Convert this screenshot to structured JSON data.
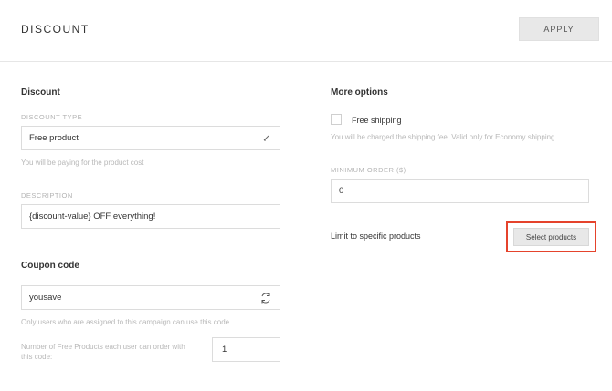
{
  "header": {
    "title": "DISCOUNT",
    "apply_label": "APPLY"
  },
  "discount": {
    "heading": "Discount",
    "type_label": "DISCOUNT TYPE",
    "type_value": "Free product",
    "type_hint": "You will be paying for the product cost",
    "description_label": "DESCRIPTION",
    "description_value": "{discount-value} OFF everything!"
  },
  "coupon": {
    "heading": "Coupon code",
    "code_value": "yousave",
    "code_hint": "Only users who are assigned to this campaign can use this code.",
    "per_user_label_line1": "Number of Free Products each user can order with",
    "per_user_label_line2": "this code:",
    "per_user_value": "1"
  },
  "more_options": {
    "heading": "More options",
    "free_shipping_label": "Free shipping",
    "free_shipping_checked": false,
    "free_shipping_hint": "You will be charged the shipping fee. Valid only for Economy shipping.",
    "minimum_order_label": "MINIMUM ORDER ($)",
    "minimum_order_value": "0",
    "limit_label": "Limit to specific products",
    "select_products_label": "Select products"
  },
  "colors": {
    "highlight": "#e5432c",
    "button_bg": "#e8e8e8"
  },
  "icons": {
    "type_dropdown": "chevron-down-icon",
    "coupon_regenerate": "refresh-icon"
  }
}
